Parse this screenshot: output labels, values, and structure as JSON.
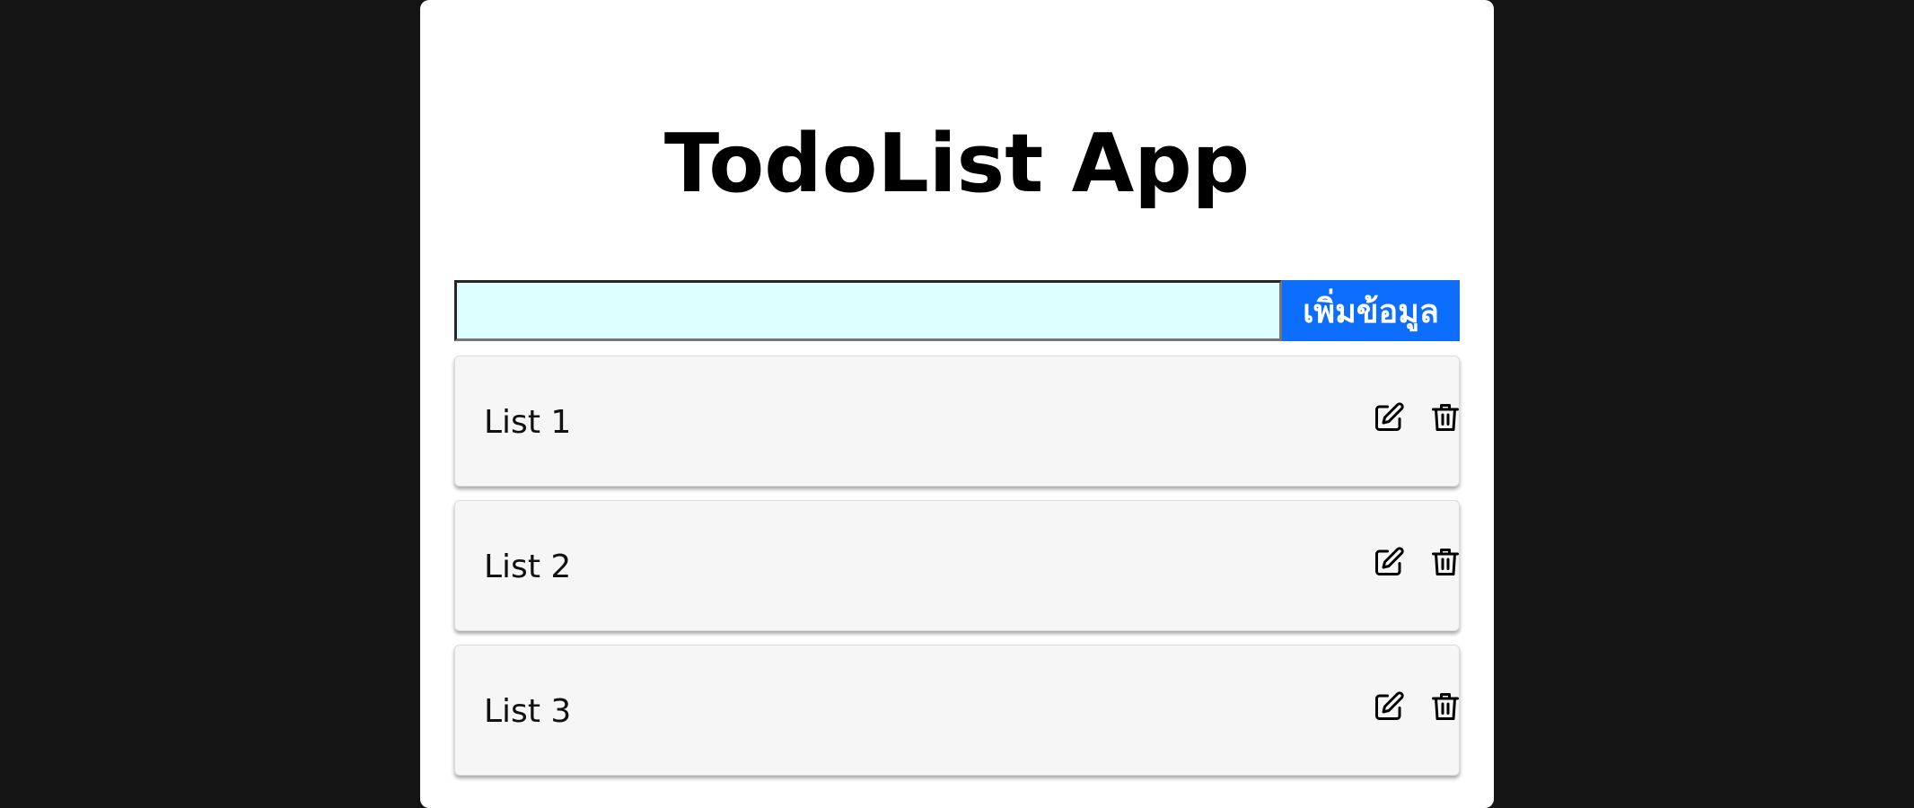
{
  "app": {
    "title": "TodoList App"
  },
  "add_form": {
    "input_value": "",
    "input_placeholder": "",
    "button_label": "เพิ่มข้อมูล"
  },
  "todos": [
    {
      "text": "List 1"
    },
    {
      "text": "List 2"
    },
    {
      "text": "List 3"
    }
  ],
  "icons": {
    "edit": "edit-icon",
    "delete": "trash-icon"
  },
  "colors": {
    "page_background": "#141414",
    "card": "#ffffff",
    "input_background": "#ddffff",
    "accent": "#0d6efd",
    "item_background": "#f6f6f6"
  }
}
